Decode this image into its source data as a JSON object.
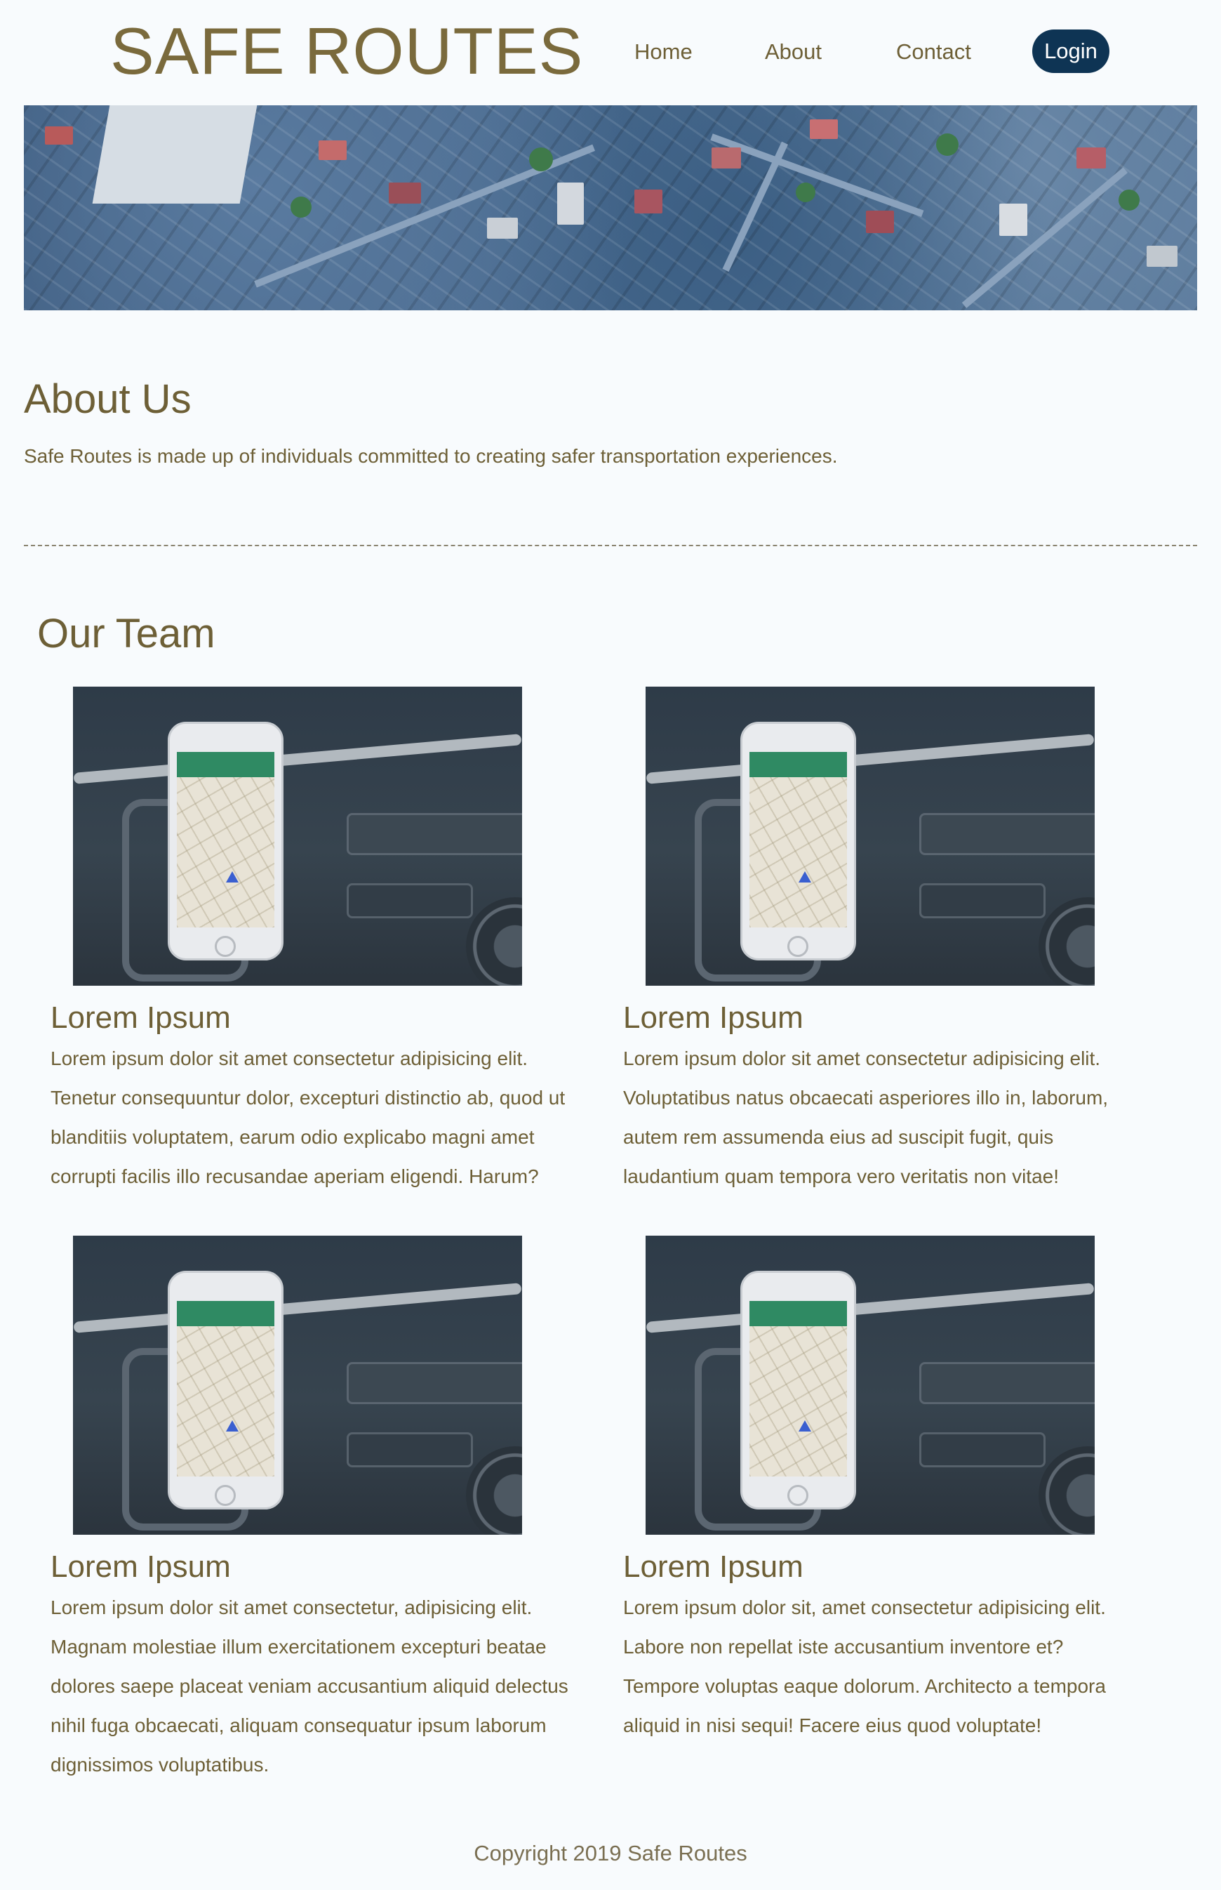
{
  "header": {
    "brand": "SAFE ROUTES",
    "nav": {
      "home": "Home",
      "about": "About",
      "contact": "Contact",
      "login": "Login"
    }
  },
  "about": {
    "title": "About Us",
    "text": "Safe Routes is made up of individuals committed to creating safer transportation experiences."
  },
  "team": {
    "title": "Our Team",
    "members": [
      {
        "name": "Lorem Ipsum",
        "bio": "Lorem ipsum dolor sit amet consectetur adipisicing elit. Tenetur consequuntur dolor, excepturi distinctio ab, quod ut blanditiis voluptatem, earum odio explicabo magni amet corrupti facilis illo recusandae aperiam eligendi. Harum?"
      },
      {
        "name": "Lorem Ipsum",
        "bio": "Lorem ipsum dolor sit amet consectetur adipisicing elit. Voluptatibus natus obcaecati asperiores illo in, laborum, autem rem assumenda eius ad suscipit fugit, quis laudantium quam tempora vero veritatis non vitae!"
      },
      {
        "name": "Lorem Ipsum",
        "bio": "Lorem ipsum dolor sit amet consectetur, adipisicing elit. Magnam molestiae illum exercitationem excepturi beatae dolores saepe placeat veniam accusantium aliquid delectus nihil fuga obcaecati, aliquam consequatur ipsum laborum dignissimos voluptatibus."
      },
      {
        "name": "Lorem Ipsum",
        "bio": "Lorem ipsum dolor sit, amet consectetur adipisicing elit. Labore non repellat iste accusantium inventore et? Tempore voluptas eaque dolorum. Architecto a tempora aliquid in nisi sequi! Facere eius quod voluptate!"
      }
    ]
  },
  "footer": {
    "copyright": "Copyright 2019 Safe Routes"
  },
  "colors": {
    "background": "#f8fbfd",
    "text": "#6d5f36",
    "login_button": "#0e3454"
  }
}
